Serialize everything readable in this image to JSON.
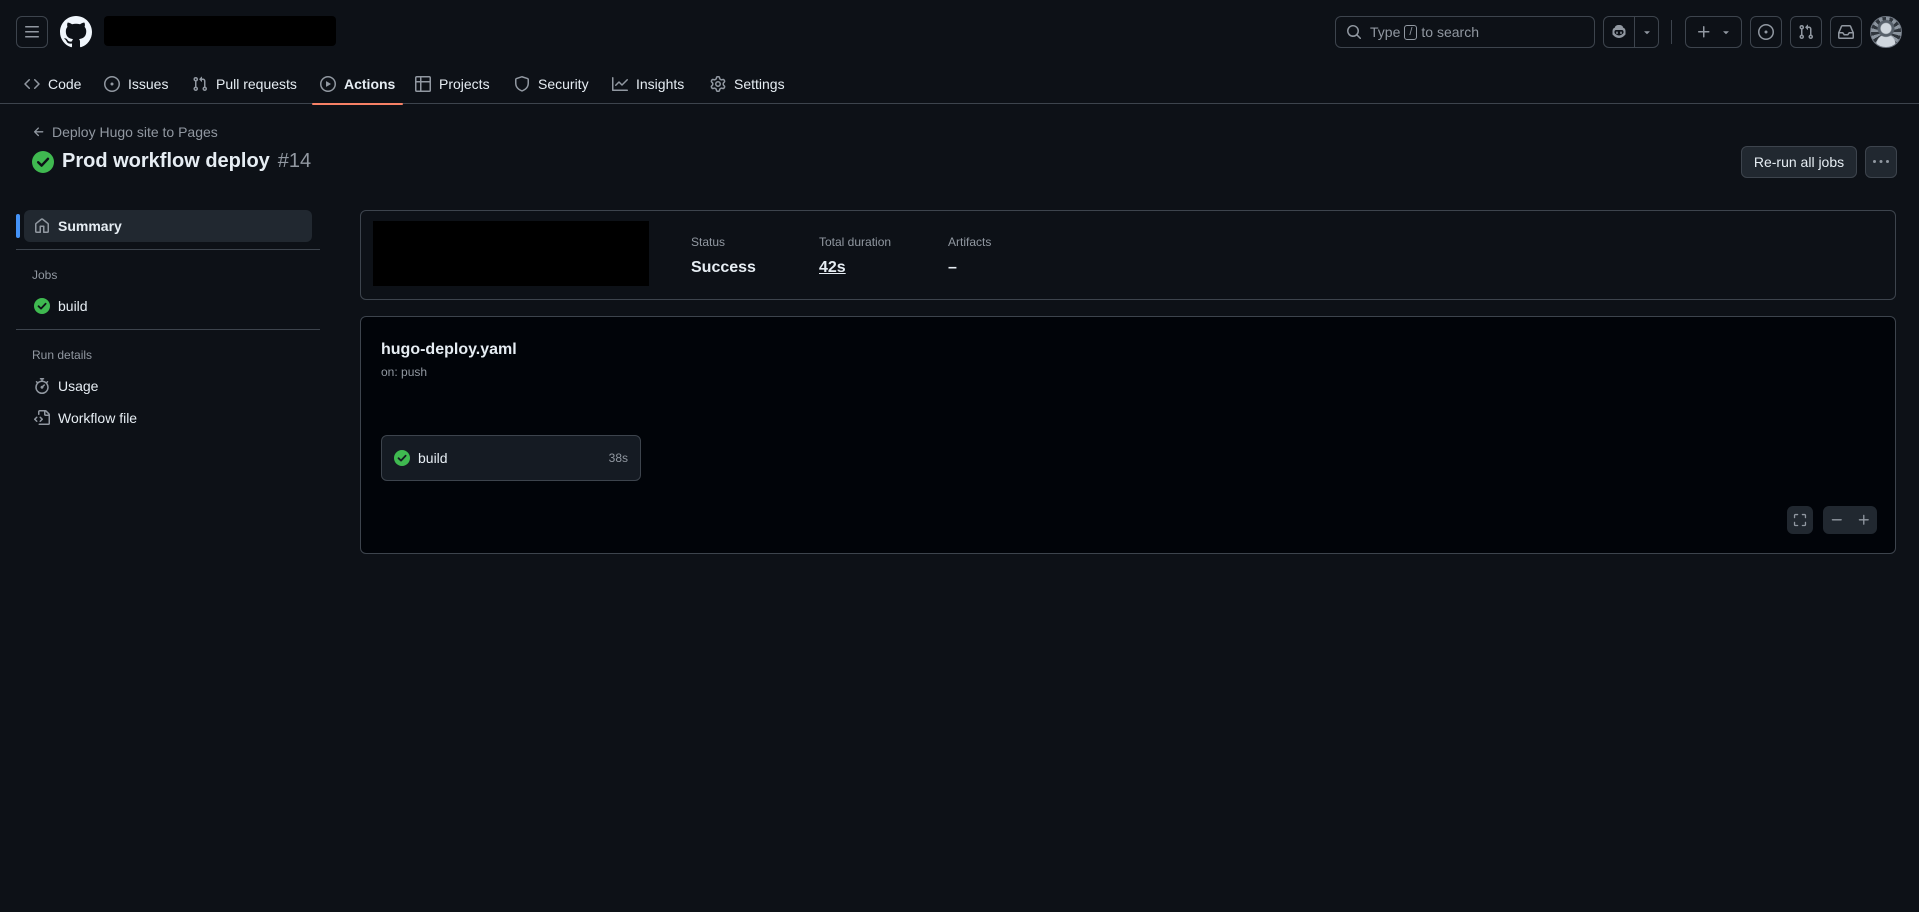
{
  "header": {
    "search_prefix": "Type",
    "search_key": "/",
    "search_suffix": "to search"
  },
  "repo_nav": {
    "tabs": [
      {
        "label": "Code",
        "icon": "code-icon"
      },
      {
        "label": "Issues",
        "icon": "issue-opened-icon"
      },
      {
        "label": "Pull requests",
        "icon": "git-pull-request-icon"
      },
      {
        "label": "Actions",
        "icon": "play-icon",
        "active": true
      },
      {
        "label": "Projects",
        "icon": "table-icon"
      },
      {
        "label": "Security",
        "icon": "shield-icon"
      },
      {
        "label": "Insights",
        "icon": "graph-icon"
      },
      {
        "label": "Settings",
        "icon": "gear-icon"
      }
    ]
  },
  "run": {
    "workflow_link": "Deploy Hugo site to Pages",
    "title": "Prod workflow deploy",
    "number": "#14",
    "status_color": "#3fb950",
    "rerun_label": "Re-run all jobs",
    "more_label": "···"
  },
  "sidebar": {
    "summary_label": "Summary",
    "jobs_heading": "Jobs",
    "jobs": [
      {
        "label": "build",
        "status": "success"
      }
    ],
    "run_details_heading": "Run details",
    "usage_label": "Usage",
    "workflow_file_label": "Workflow file"
  },
  "summary": {
    "status_label": "Status",
    "status_value": "Success",
    "duration_label": "Total duration",
    "duration_value": "42s",
    "artifacts_label": "Artifacts",
    "artifacts_value": "–"
  },
  "graph": {
    "workflow_file": "hugo-deploy.yaml",
    "trigger": "on: push",
    "job": {
      "name": "build",
      "duration": "38s"
    }
  },
  "colors": {
    "accent_tab": "#f78166",
    "selected_indicator": "#4493f8",
    "success": "#3fb950"
  }
}
